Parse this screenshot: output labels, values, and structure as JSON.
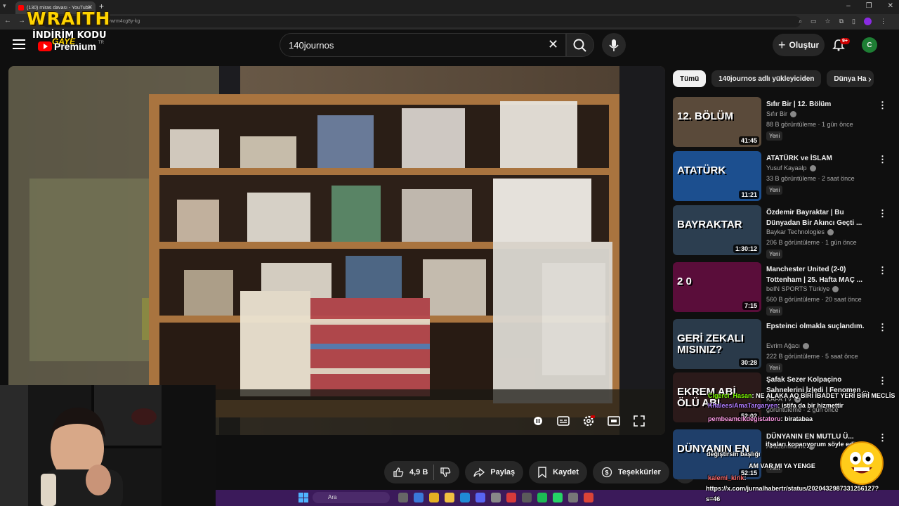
{
  "browser": {
    "tab_title": "(130) miras davası - YouTube",
    "new_tab_glyph": "+",
    "url_partial": "=vwrm4cg8y-kg",
    "window_controls": [
      "–",
      "❐",
      "✕"
    ]
  },
  "overlay": {
    "brand": "WRAITH",
    "promo": "İNDİRİM KODU",
    "promo_code": "GAYE"
  },
  "header": {
    "logo_text": "Premium",
    "logo_region": "TR",
    "search_value": "140journos",
    "create_label": "Oluştur",
    "notifications_badge": "9+",
    "avatar_initial": "C"
  },
  "actions": {
    "likes": "4,9 B",
    "share": "Paylaş",
    "save": "Kaydet",
    "thanks": "Teşekkürler",
    "more": "•••"
  },
  "chips": [
    "Tümü",
    "140journos adlı yükleyiciden",
    "Dünya Ha"
  ],
  "recommendations": [
    {
      "title": "Sıfır Bir | 12. Bölüm",
      "channel": "Sıfır Bir",
      "meta": "88 B görüntüleme · 1 gün önce",
      "badge": "Yeni",
      "duration": "41:45",
      "thumb_text": "12. BÖLÜM",
      "thumb_color": "#5a4a3a"
    },
    {
      "title": "ATATÜRK ve İSLAM",
      "channel": "Yusuf Kayaalp",
      "meta": "33 B görüntüleme · 2 saat önce",
      "badge": "Yeni",
      "duration": "11:21",
      "thumb_text": "ATATÜRK",
      "thumb_color": "#1c4f8f"
    },
    {
      "title": "Özdemir Bayraktar | Bu Dünyadan Bir Akıncı Geçti ...",
      "channel": "Baykar Technologies",
      "meta": "206 B görüntüleme · 1 gün önce",
      "badge": "Yeni",
      "duration": "1:30:12",
      "thumb_text": "BAYRAKTAR",
      "thumb_color": "#2c3e50"
    },
    {
      "title": "Manchester United (2-0) Tottenham | 25. Hafta MAÇ ...",
      "channel": "beIN SPORTS Türkiye",
      "meta": "560 B görüntüleme · 20 saat önce",
      "badge": "Yeni",
      "duration": "7:15",
      "thumb_text": "2 0",
      "thumb_color": "#5a0d3a"
    },
    {
      "title": "Epsteinci olmakla suçlandım.",
      "channel": "Evrim Ağacı",
      "meta": "222 B görüntüleme · 5 saat önce",
      "badge": "Yeni",
      "duration": "30:28",
      "thumb_text": "GERİ ZEKALI MISINIZ?",
      "thumb_color": "#2a3a4a"
    },
    {
      "title": "Şafak Sezer Kolpaçino Sahnelerini İzledi | Fenomen ...",
      "channel": "KAFA TV",
      "meta": "görüntüleme · 2 gün önce",
      "badge": "",
      "duration": "52:02",
      "thumb_text": "EKREM ABİ ÖLÜ ABİ",
      "thumb_color": "#2b1a1a"
    },
    {
      "title": "DÜNYANIN EN MUTLU Ü...",
      "channel": "AkademikLink",
      "meta": "",
      "badge": "Yeni",
      "duration": "52:15",
      "thumb_text": "DÜNYANIN EN",
      "thumb_color": "#1f3f6a"
    }
  ],
  "chat": [
    {
      "user": "Cigerci_Hasan",
      "msg": ": NE ALAKA AQ BİRİ İBADET YERİ BİRİ MECLİS",
      "color": "#7CFC00"
    },
    {
      "user": "KhaleesiAmaTargaryen",
      "msg": ": istifa da bir hizmettir",
      "color": "#b07cff"
    },
    {
      "user": "pembeamcikdegistatoru",
      "msg": ": biratabaa",
      "color": "#ff9ce6"
    },
    {
      "user": "",
      "msg": "ifşaları koparıyorum söyle editöre",
      "color": "#fff"
    },
    {
      "user": "",
      "msg": "değiştirsin başlığı",
      "color": "#fff"
    },
    {
      "user": "",
      "msg": "AM VAR MI YA YENGE",
      "color": "#fff"
    },
    {
      "user": "kalemi_kirik",
      "msg": ":",
      "color": "#ff6b6b"
    },
    {
      "user": "",
      "msg": "https://x.com/jurnalhabertr/status/2020432987331256127?",
      "color": "#fff"
    },
    {
      "user": "",
      "msg": "s=46",
      "color": "#fff"
    }
  ],
  "taskbar": {
    "search_label": "Ara"
  },
  "colors": {
    "youtube_red": "#ff0000",
    "bg": "#0f0f0f",
    "overlay_yellow": "#ffd400",
    "taskbar": "#3b1a5a"
  }
}
